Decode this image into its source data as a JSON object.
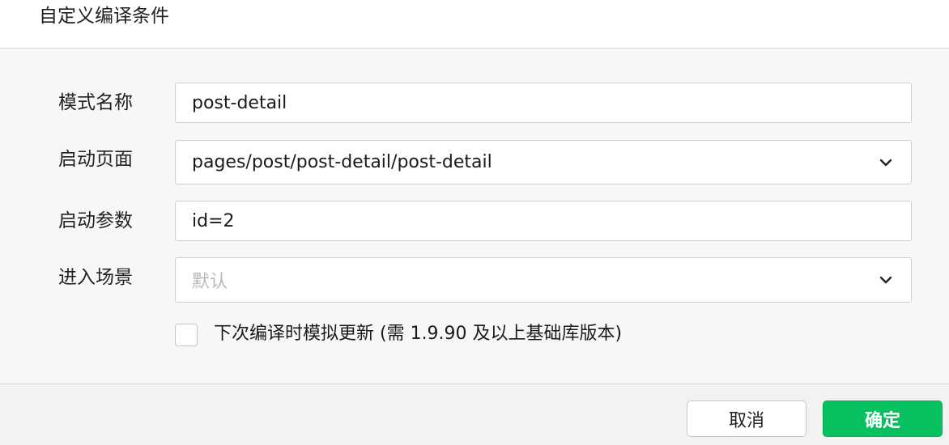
{
  "dialog": {
    "title": "自定义编译条件"
  },
  "form": {
    "mode_name": {
      "label": "模式名称",
      "value": "post-detail"
    },
    "launch_page": {
      "label": "启动页面",
      "value": "pages/post/post-detail/post-detail",
      "icon": "chevron-down-icon"
    },
    "launch_params": {
      "label": "启动参数",
      "value": "id=2"
    },
    "scene": {
      "label": "进入场景",
      "placeholder": "默认",
      "icon": "chevron-down-icon"
    },
    "simulate_update": {
      "label": "下次编译时模拟更新 (需 1.9.90 及以上基础库版本)",
      "checked": false
    }
  },
  "footer": {
    "cancel_label": "取消",
    "ok_label": "确定"
  },
  "colors": {
    "primary": "#07c160",
    "form_background": "#f7f7f7",
    "placeholder": "#b8b8b8"
  }
}
